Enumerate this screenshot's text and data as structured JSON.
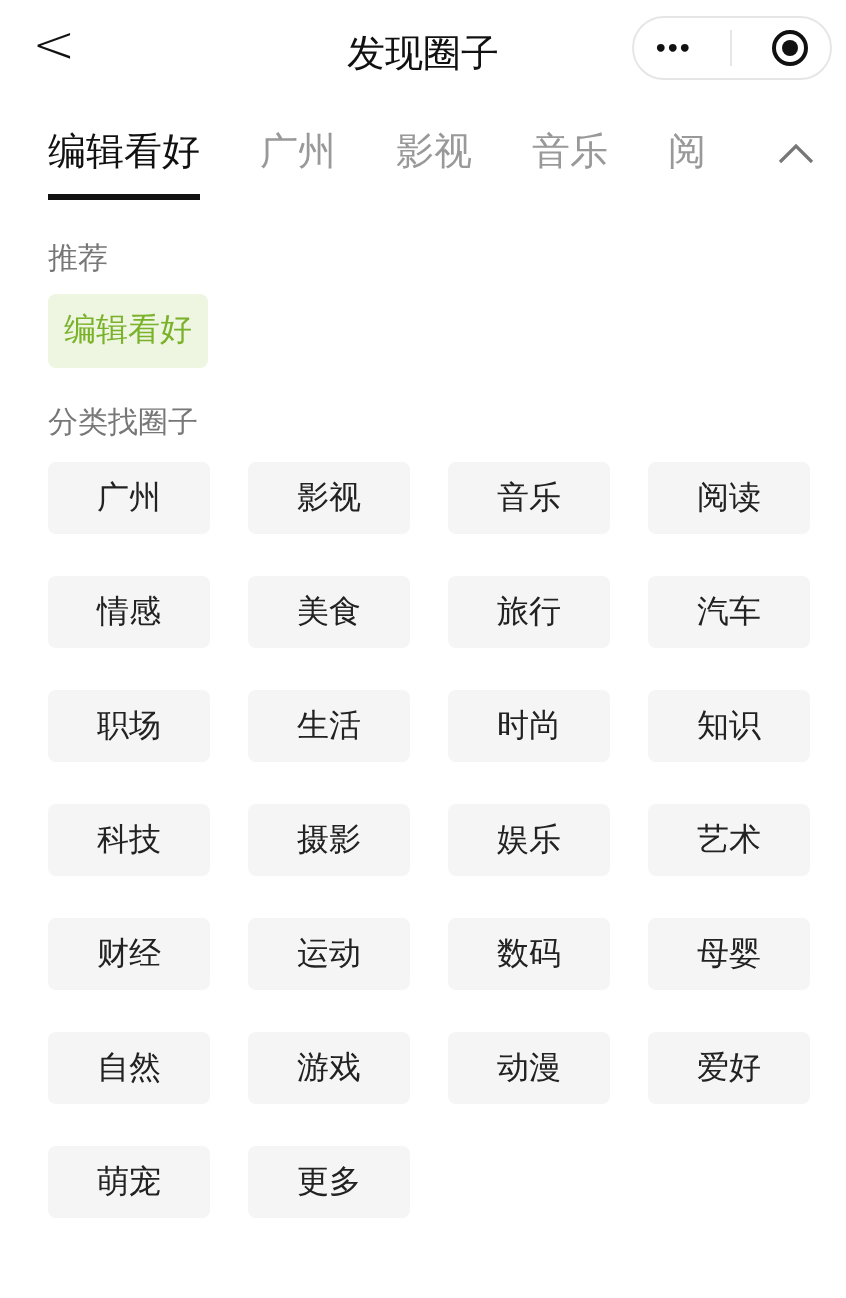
{
  "header": {
    "back": "<",
    "title": "发现圈子",
    "more": "•••"
  },
  "tabs": [
    {
      "label": "编辑看好",
      "selected": true
    },
    {
      "label": "广州",
      "selected": false
    },
    {
      "label": "影视",
      "selected": false
    },
    {
      "label": "音乐",
      "selected": false
    },
    {
      "label": "阅",
      "selected": false
    }
  ],
  "recommend": {
    "title": "推荐",
    "items": [
      {
        "label": "编辑看好",
        "selected": true
      }
    ]
  },
  "categories": {
    "title": "分类找圈子",
    "items": [
      "广州",
      "影视",
      "音乐",
      "阅读",
      "情感",
      "美食",
      "旅行",
      "汽车",
      "职场",
      "生活",
      "时尚",
      "知识",
      "科技",
      "摄影",
      "娱乐",
      "艺术",
      "财经",
      "运动",
      "数码",
      "母婴",
      "自然",
      "游戏",
      "动漫",
      "爱好",
      "萌宠",
      "更多"
    ]
  }
}
